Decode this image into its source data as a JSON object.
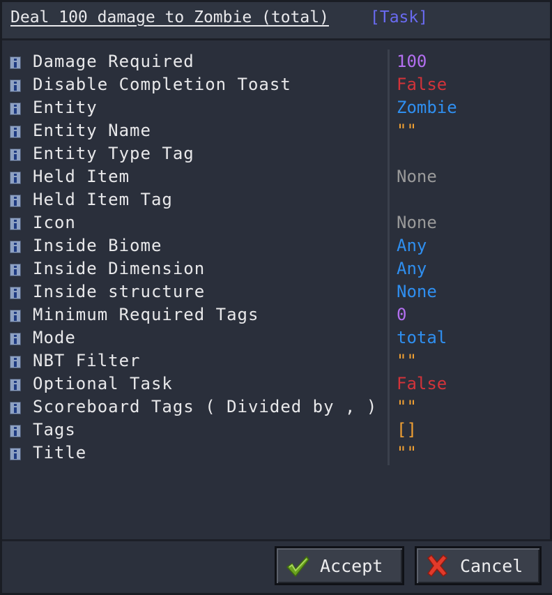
{
  "title": {
    "main": "Deal 100 damage to Zombie (total)",
    "tag": "[Task]"
  },
  "rows": [
    {
      "label": "Damage Required",
      "value": "100",
      "color": "#b36ff0"
    },
    {
      "label": "Disable Completion Toast",
      "value": "False",
      "color": "#d2333a"
    },
    {
      "label": "Entity",
      "value": "Zombie",
      "color": "#2f8ff0"
    },
    {
      "label": "Entity Name",
      "value": "\"\"",
      "color": "#f0a033"
    },
    {
      "label": "Entity Type Tag",
      "value": "",
      "color": "#e8e8ea"
    },
    {
      "label": "Held Item",
      "value": "None",
      "color": "#9a9a9a"
    },
    {
      "label": "Held Item Tag",
      "value": "",
      "color": "#e8e8ea"
    },
    {
      "label": "Icon",
      "value": "None",
      "color": "#9a9a9a"
    },
    {
      "label": "Inside Biome",
      "value": "Any",
      "color": "#2f8ff0"
    },
    {
      "label": "Inside Dimension",
      "value": "Any",
      "color": "#2f8ff0"
    },
    {
      "label": "Inside structure",
      "value": "None",
      "color": "#2f8ff0"
    },
    {
      "label": "Minimum Required Tags",
      "value": "0",
      "color": "#b36ff0"
    },
    {
      "label": "Mode",
      "value": "total",
      "color": "#2f8ff0"
    },
    {
      "label": "NBT Filter",
      "value": "\"\"",
      "color": "#f0a033"
    },
    {
      "label": "Optional Task",
      "value": "False",
      "color": "#d2333a"
    },
    {
      "label": "Scoreboard Tags ( Divided by , )",
      "value": "\"\"",
      "color": "#f0a033"
    },
    {
      "label": "Tags",
      "value": "[]",
      "color": "#f0a033"
    },
    {
      "label": "Title",
      "value": "\"\"",
      "color": "#f0a033"
    }
  ],
  "buttons": {
    "accept": "Accept",
    "cancel": "Cancel"
  }
}
